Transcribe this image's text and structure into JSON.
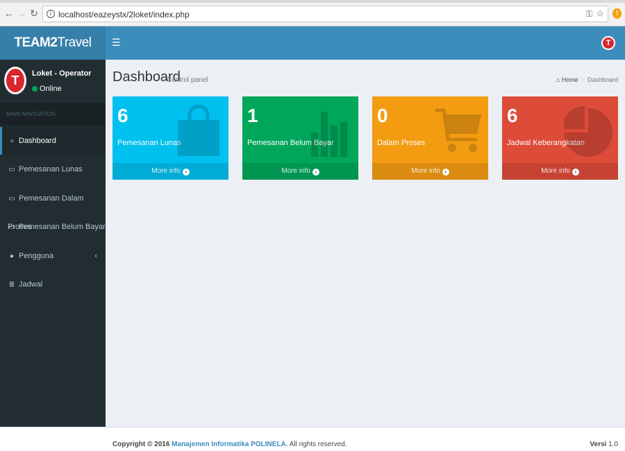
{
  "browser": {
    "url": "localhost/eazeystx/2loket/index.php"
  },
  "header": {
    "logo_bold": "TEAM2",
    "logo_rest": "Travel",
    "avatar_letter": "T"
  },
  "sidebar": {
    "user_avatar_letter": "T",
    "user_name": "Loket - Operator",
    "user_status": "Online",
    "nav_header": "MAIN NAVIGATION",
    "items": [
      {
        "label": "Dashboard",
        "icon": "circle-o-icon"
      },
      {
        "label": "Pemesanan Lunas",
        "icon": "laptop-icon"
      },
      {
        "label": "Pemesanan Dalam Proses",
        "icon": "laptop-icon"
      },
      {
        "label": "Pemesanan Belum Bayar",
        "icon": "laptop-icon"
      },
      {
        "label": "Pengguna",
        "icon": "user-icon"
      },
      {
        "label": "Jadwal",
        "icon": "list-icon"
      }
    ]
  },
  "content": {
    "title": "Dashboard",
    "subtitle": "Control panel",
    "breadcrumb": {
      "home": "Home",
      "current": "Dashboard"
    },
    "boxes": [
      {
        "value": "6",
        "label": "Pemesanan Lunas",
        "footer": "More info",
        "color": "#00c0ef",
        "icon": "shopping-bag-icon"
      },
      {
        "value": "1",
        "label": "Pemesanan Belum Bayar",
        "footer": "More info",
        "color": "#00a65a",
        "icon": "bar-chart-icon"
      },
      {
        "value": "0",
        "label": "Dalam Proses",
        "footer": "More info",
        "color": "#f39c12",
        "icon": "shopping-cart-icon"
      },
      {
        "value": "6",
        "label": "Jadwal Keberangkatan",
        "footer": "More info",
        "color": "#dd4b39",
        "icon": "pie-chart-icon"
      }
    ]
  },
  "footer": {
    "copyright_prefix": "Copyright © 2016",
    "copyright_link": "Manajemen Informatika POLINELA.",
    "copyright_suffix": "All rights reserved.",
    "version_label": "Versi",
    "version_number": "1.0"
  }
}
